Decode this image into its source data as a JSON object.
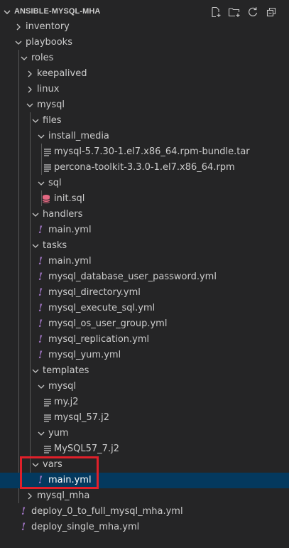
{
  "explorer": {
    "title": "ANSIBLE-MYSQL-MHA"
  },
  "colors": {
    "background": "#252526",
    "selection": "#04395e",
    "yml_icon": "#a074c4",
    "sql_icon": "#e36882",
    "highlight": "#e0202a"
  },
  "tree": {
    "inventory": "inventory",
    "playbooks": "playbooks",
    "roles": "roles",
    "keepalived": "keepalived",
    "linux": "linux",
    "mysql": "mysql",
    "files": "files",
    "install_media": "install_media",
    "mysql_bundle": "mysql-5.7.30-1.el7.x86_64.rpm-bundle.tar",
    "percona": "percona-toolkit-3.3.0-1.el7.x86_64.rpm",
    "sql": "sql",
    "init_sql": "init.sql",
    "handlers": "handlers",
    "handlers_main": "main.yml",
    "tasks": "tasks",
    "tasks_main": "main.yml",
    "task_db_pw": "mysql_database_user_password.yml",
    "task_dir": "mysql_directory.yml",
    "task_exec": "mysql_execute_sql.yml",
    "task_os": "mysql_os_user_group.yml",
    "task_repl": "mysql_replication.yml",
    "task_yum": "mysql_yum.yml",
    "templates": "templates",
    "tpl_mysql": "mysql",
    "my_j2": "my.j2",
    "mysql57_j2": "mysql_57.j2",
    "tpl_yum": "yum",
    "mysql57_7_j2": "MySQL57_7.j2",
    "vars": "vars",
    "vars_main": "main.yml",
    "mysql_mha": "mysql_mha",
    "deploy_full": "deploy_0_to_full_mysql_mha.yml",
    "deploy_single": "deploy_single_mha.yml"
  }
}
